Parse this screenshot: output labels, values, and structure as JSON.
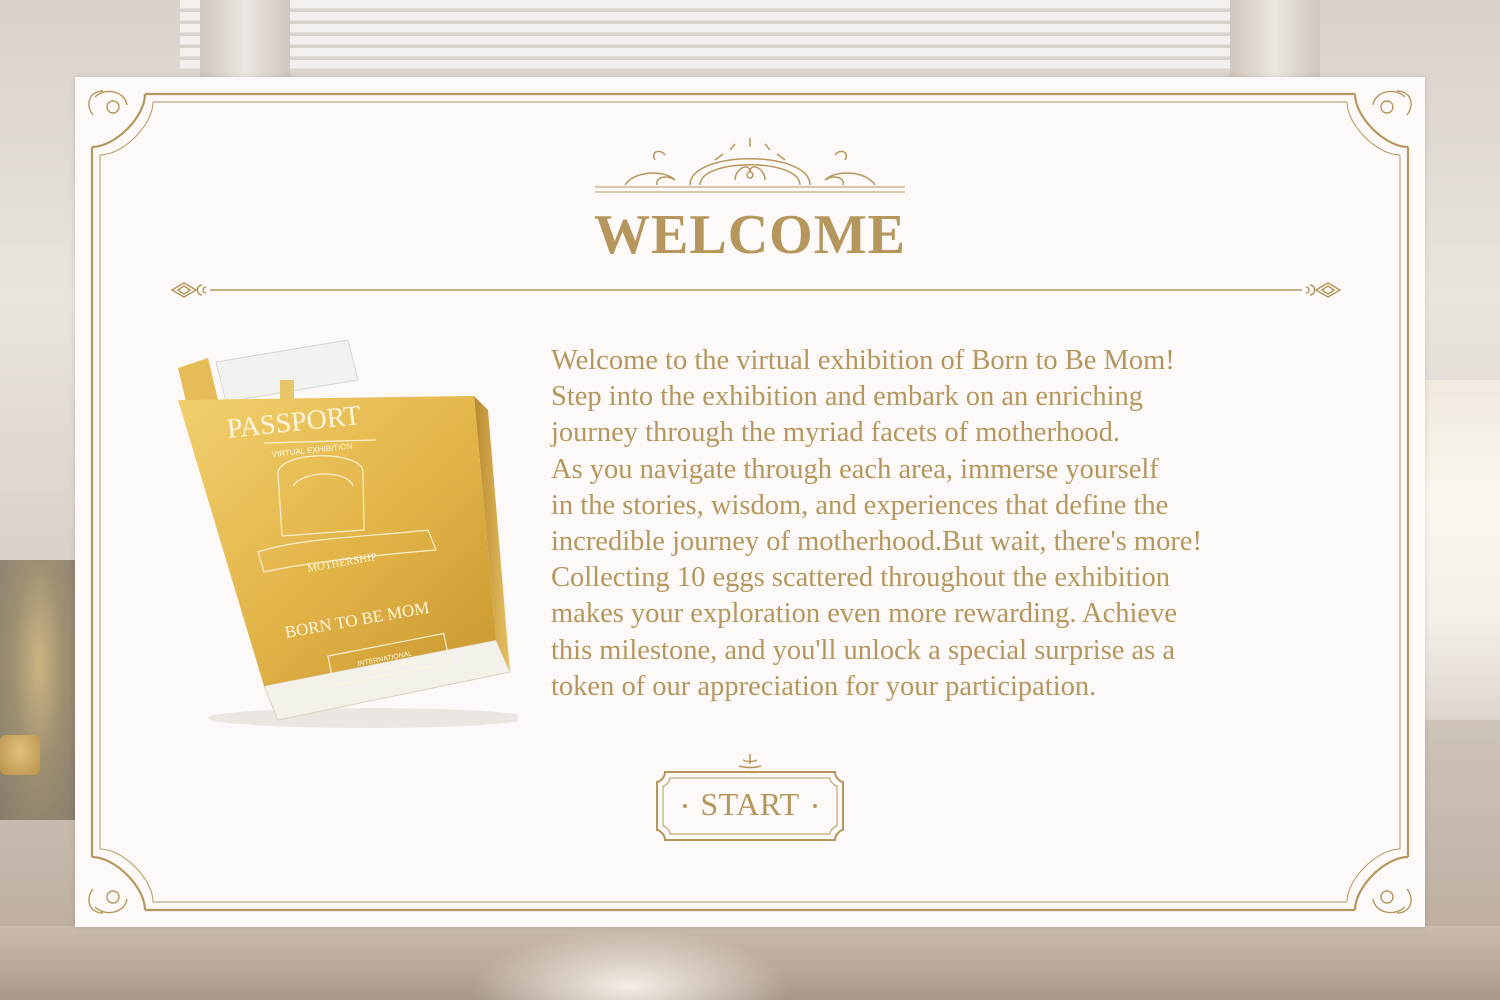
{
  "dialog": {
    "title": "WELCOME",
    "paragraph_lines": [
      "Welcome to the virtual exhibition of Born to Be Mom!",
      "Step into the exhibition and embark on an enriching",
      "journey through the myriad facets of motherhood.",
      "As you navigate through each area, immerse yourself",
      "in the stories, wisdom, and experiences that define the",
      "incredible journey of motherhood.But wait, there's more!",
      "Collecting 10 eggs scattered throughout the exhibition",
      "makes your exploration even more rewarding. Achieve",
      "this milestone, and you'll unlock a special surprise as a",
      "token of our appreciation for your participation."
    ],
    "start_label": "START"
  },
  "passport": {
    "title": "PASSPORT",
    "subtitle": "VIRTUAL EXHIBITION",
    "ribbon": "MOTHERSHIP",
    "name": "BORN TO BE MOM",
    "badge_line1": "INTERNATIONAL",
    "badge_line2": "IDENTIFICATION"
  },
  "colors": {
    "gold": "#b5975e",
    "card_background": "#fcf9f8",
    "passport_gold": "#e2b84c"
  }
}
